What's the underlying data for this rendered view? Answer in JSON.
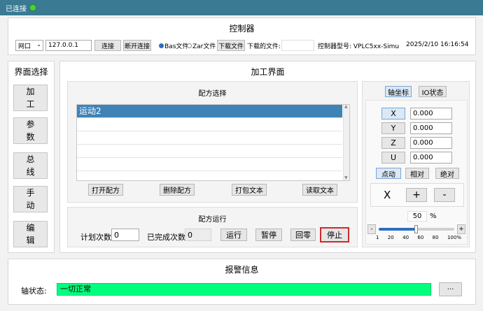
{
  "status": {
    "connected_label": "已连接"
  },
  "controller": {
    "title": "控制器",
    "port_select": "网口",
    "ip": "127.0.0.1",
    "connect_btn": "连接",
    "disconnect_btn": "断开连接",
    "radio_bas": "Bas文件",
    "radio_zar": "Zar文件",
    "download_btn": "下载文件",
    "downloaded_label": "下载的文件:",
    "downloaded_value": "",
    "model_label": "控制器型号: VPLC5xx-Simu",
    "datetime": "2025/2/10 16:16:54"
  },
  "nav": {
    "title": "界面选择",
    "items": [
      "加工",
      "参数",
      "总线",
      "手动",
      "编辑"
    ]
  },
  "main": {
    "title": "加工界面"
  },
  "recipe": {
    "title": "配方选择",
    "items": [
      "运动2"
    ],
    "open_btn": "打开配方",
    "delete_btn": "删除配方",
    "pack_btn": "打包文本",
    "read_btn": "读取文本"
  },
  "run": {
    "title": "配方运行",
    "plan_label": "计划次数",
    "plan_value": "0",
    "done_label": "已完成次数",
    "done_value": "0",
    "run_btn": "运行",
    "pause_btn": "暂停",
    "home_btn": "回零",
    "stop_btn": "停止"
  },
  "axis": {
    "tab_coord": "轴坐标",
    "tab_io": "IO状态",
    "axes": [
      {
        "name": "X",
        "value": "0.000"
      },
      {
        "name": "Y",
        "value": "0.000"
      },
      {
        "name": "Z",
        "value": "0.000"
      },
      {
        "name": "U",
        "value": "0.000"
      }
    ],
    "mode_jog": "点动",
    "mode_rel": "相对",
    "mode_abs": "绝对",
    "jog_axis": "X",
    "plus": "+",
    "minus": "-",
    "speed_value": "50",
    "speed_unit": "%",
    "speed_percent": 50,
    "slider_ticks": [
      "1",
      "20",
      "40",
      "60",
      "80",
      "100%"
    ]
  },
  "alarm": {
    "title": "报警信息",
    "axis_state_label": "轴状态:",
    "axis_state_value": "一切正常",
    "more_btn": "···"
  },
  "colors": {
    "ok_green": "#00ff7f",
    "select_blue": "#3f83b6",
    "title_teal": "#3a7a92",
    "stop_red": "#d02828"
  }
}
